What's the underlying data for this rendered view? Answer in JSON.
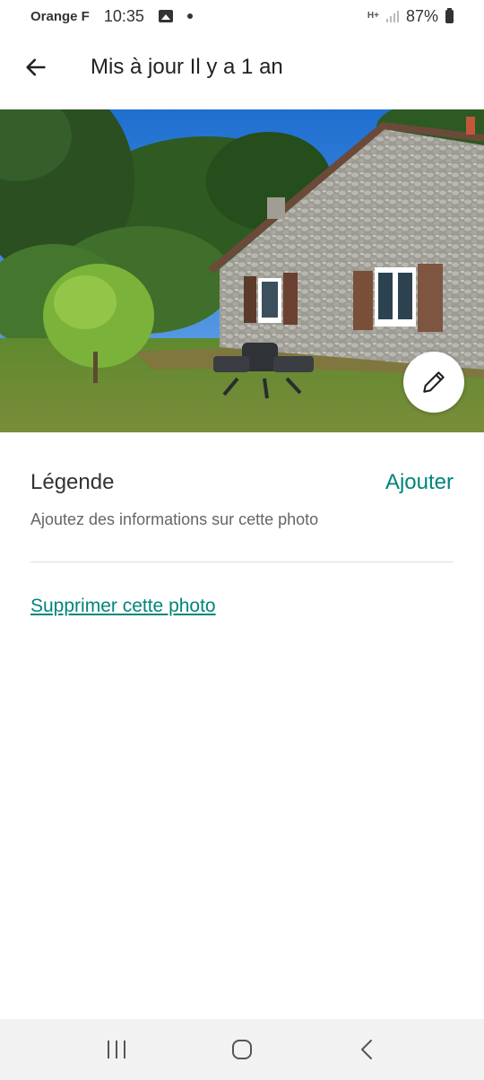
{
  "status_bar": {
    "carrier": "Orange F",
    "time": "10:35",
    "network": "H+",
    "battery": "87%"
  },
  "header": {
    "title": "Mis à jour Il y a 1 an",
    "back_icon": "arrow-left-icon"
  },
  "photo": {
    "description_icon": "house-photo",
    "edit_icon": "pencil-icon"
  },
  "caption": {
    "label": "Légende",
    "add_label": "Ajouter",
    "placeholder": "Ajoutez des informations sur cette photo"
  },
  "actions": {
    "delete_label": "Supprimer cette photo"
  },
  "colors": {
    "accent": "#00857a",
    "text": "#222222",
    "muted": "#666666"
  },
  "nav_bar": {
    "recent_icon": "recent-apps-icon",
    "home_icon": "home-icon",
    "back_icon": "back-icon"
  }
}
